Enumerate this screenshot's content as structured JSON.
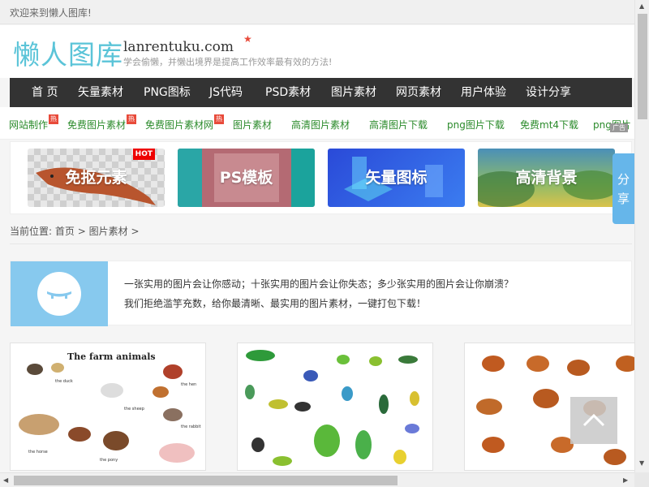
{
  "topbar": {
    "welcome": "欢迎来到懒人图库!"
  },
  "header": {
    "logo_cn": "懒人图库",
    "logo_en": "lanrentuku.com",
    "slogan": "学会偷懒，并懒出境界是提高工作效率最有效的方法!"
  },
  "nav": [
    "首 页",
    "矢量素材",
    "PNG图标",
    "JS代码",
    "PSD素材",
    "图片素材",
    "网页素材",
    "用户体验",
    "设计分享"
  ],
  "links": [
    {
      "label": "网站制作",
      "hot": true
    },
    {
      "label": "免费图片素材",
      "hot": true
    },
    {
      "label": "免费图片素材网",
      "hot": true
    },
    {
      "label": "图片素材",
      "hot": false
    },
    {
      "label": "高清图片素材",
      "hot": false
    },
    {
      "label": "高清图片下载",
      "hot": false
    },
    {
      "label": "png图片下载",
      "hot": false
    },
    {
      "label": "免费mt4下载",
      "hot": false
    },
    {
      "label": "png图片",
      "hot": false
    }
  ],
  "hot_label": "热",
  "ad_label": "广告",
  "banners": [
    {
      "label": "免抠元素",
      "badge": "HOT"
    },
    {
      "label": "PS模板"
    },
    {
      "label": "矢量图标"
    },
    {
      "label": "高清背景"
    }
  ],
  "share": "分享",
  "breadcrumb": {
    "prefix": "当前位置:",
    "home": "首页",
    "sep": ">",
    "current": "图片素材"
  },
  "intro": {
    "line1": "一张实用的图片会让你感动；十张实用的图片会让你失态；多少张实用的图片会让你崩溃？",
    "line2": "我们拒绝滥竽充数，给你最清晰、最实用的图片素材，一键打包下载！"
  },
  "cards": [
    {
      "title": "The farm animals",
      "labels": [
        "the duck",
        "the hen",
        "the sheep",
        "the rabbit",
        "the horse",
        "the pony"
      ]
    },
    {
      "title": ""
    },
    {
      "title": ""
    }
  ]
}
